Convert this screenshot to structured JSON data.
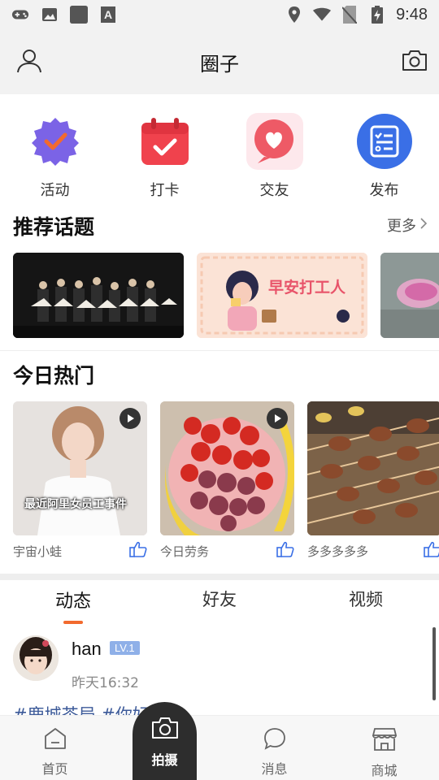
{
  "status_bar": {
    "time": "9:48",
    "left_icons": [
      "gamepad-icon",
      "image-icon",
      "square-app-icon",
      "font-a-icon"
    ],
    "right_icons": [
      "location-icon",
      "wifi-icon",
      "no-sim-icon",
      "battery-charging-icon"
    ]
  },
  "header": {
    "title": "圈子",
    "left_icon": "user-icon",
    "right_icon": "camera-icon"
  },
  "quick_actions": [
    {
      "label": "活动",
      "icon": "badge-check-icon",
      "color": "#7b63e6"
    },
    {
      "label": "打卡",
      "icon": "calendar-check-icon",
      "color": "#f0424d"
    },
    {
      "label": "交友",
      "icon": "heart-chat-icon",
      "color": "#ee5a66"
    },
    {
      "label": "发布",
      "icon": "checklist-icon",
      "color": "#3a6fe6"
    }
  ],
  "recommended": {
    "title": "推荐话题",
    "more": "更多",
    "topics": [
      {
        "caption": ""
      },
      {
        "caption": "早安打工人"
      },
      {
        "caption": ""
      }
    ]
  },
  "hot_today": {
    "title": "今日热门",
    "items": [
      {
        "author": "宇宙小蛙",
        "overlay": "最近阿里女员工事件",
        "video": true
      },
      {
        "author": "今日劳务",
        "overlay": "",
        "video": true
      },
      {
        "author": "多多多多多",
        "overlay": "",
        "video": false
      }
    ]
  },
  "feed_tabs": {
    "tabs": [
      "动态",
      "好友",
      "视频"
    ],
    "active": 0
  },
  "post": {
    "user": "han",
    "level": "LV.1",
    "time": "昨天16:32",
    "text": "#鹿城茶局 #你好"
  },
  "bottom_nav": {
    "items": [
      {
        "label": "首页",
        "icon": "home-icon"
      },
      {
        "label": "拍摄",
        "icon": "camera-icon"
      },
      {
        "label": "消息",
        "icon": "chat-bubble-icon"
      },
      {
        "label": "商城",
        "icon": "shop-icon"
      }
    ]
  },
  "colors": {
    "accent": "#f26a2e",
    "level_badge": "#8fb0e8",
    "hashtag": "#3c5a99"
  }
}
